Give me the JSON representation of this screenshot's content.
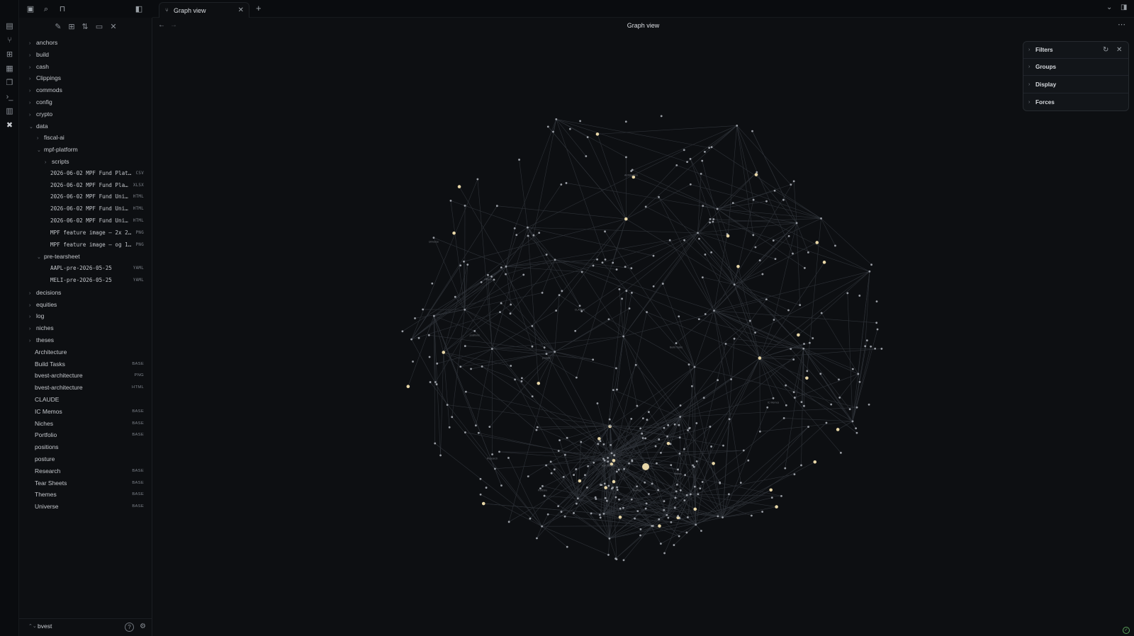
{
  "ribbon": {
    "icons": [
      "file-icon",
      "graph-icon",
      "grid-icon",
      "calendar-icon",
      "copy-icon",
      "terminal-icon",
      "blocks-icon",
      "tools-icon"
    ]
  },
  "sidebar_top": {
    "icons": [
      "folder-icon",
      "search-icon",
      "bookmark-icon",
      "sidebar-toggle-icon"
    ]
  },
  "explorer": {
    "actions": [
      "new-note-icon",
      "new-folder-icon",
      "sort-icon",
      "collapse-icon",
      "close-icon"
    ],
    "items": [
      {
        "label": "anchors",
        "depth": 0,
        "chev": "›"
      },
      {
        "label": "build",
        "depth": 0,
        "chev": "›"
      },
      {
        "label": "cash",
        "depth": 0,
        "chev": "›"
      },
      {
        "label": "Clippings",
        "depth": 0,
        "chev": "›"
      },
      {
        "label": "commods",
        "depth": 0,
        "chev": "›"
      },
      {
        "label": "config",
        "depth": 0,
        "chev": "›"
      },
      {
        "label": "crypto",
        "depth": 0,
        "chev": "›"
      },
      {
        "label": "data",
        "depth": 0,
        "chev": "⌄"
      },
      {
        "label": "fiscal-ai",
        "depth": 1,
        "chev": "›"
      },
      {
        "label": "mpf-platform",
        "depth": 1,
        "chev": "⌄"
      },
      {
        "label": "scripts",
        "depth": 2,
        "chev": "›"
      },
      {
        "label": "2026-06-02 MPF Fund Plat…",
        "depth": 2,
        "ext": "CSV",
        "mono": true
      },
      {
        "label": "2026-06-02 MPF Fund Pla…",
        "depth": 2,
        "ext": "XLSX",
        "mono": true
      },
      {
        "label": "2026-06-02 MPF Fund Uni…",
        "depth": 2,
        "ext": "HTML",
        "mono": true
      },
      {
        "label": "2026-06-02 MPF Fund Uni…",
        "depth": 2,
        "ext": "HTML",
        "mono": true
      },
      {
        "label": "2026-06-02 MPF Fund Uni…",
        "depth": 2,
        "ext": "HTML",
        "mono": true
      },
      {
        "label": "MPF feature image – 2x 2…",
        "depth": 2,
        "ext": "PNG",
        "mono": true
      },
      {
        "label": "MPF feature image – og 1…",
        "depth": 2,
        "ext": "PNG",
        "mono": true
      },
      {
        "label": "pre-tearsheet",
        "depth": 1,
        "chev": "⌄"
      },
      {
        "label": "AAPL-pre-2026-05-25",
        "depth": 2,
        "ext": "YAML",
        "mono": true
      },
      {
        "label": "MELI-pre-2026-05-25",
        "depth": 2,
        "ext": "YAML",
        "mono": true
      },
      {
        "label": "decisions",
        "depth": 0,
        "chev": "›"
      },
      {
        "label": "equities",
        "depth": 0,
        "chev": "›"
      },
      {
        "label": "log",
        "depth": 0,
        "chev": "›"
      },
      {
        "label": "niches",
        "depth": 0,
        "chev": "›"
      },
      {
        "label": "theses",
        "depth": 0,
        "chev": "›"
      },
      {
        "label": "Architecture",
        "depth": 0
      },
      {
        "label": "Build Tasks",
        "depth": 0,
        "ext": "BASE"
      },
      {
        "label": "bvest-architecture",
        "depth": 0,
        "ext": "PNG"
      },
      {
        "label": "bvest-architecture",
        "depth": 0,
        "ext": "HTML"
      },
      {
        "label": "CLAUDE",
        "depth": 0
      },
      {
        "label": "IC Memos",
        "depth": 0,
        "ext": "BASE"
      },
      {
        "label": "Niches",
        "depth": 0,
        "ext": "BASE"
      },
      {
        "label": "Portfolio",
        "depth": 0,
        "ext": "BASE"
      },
      {
        "label": "positions",
        "depth": 0
      },
      {
        "label": "posture",
        "depth": 0
      },
      {
        "label": "Research",
        "depth": 0,
        "ext": "BASE"
      },
      {
        "label": "Tear Sheets",
        "depth": 0,
        "ext": "BASE"
      },
      {
        "label": "Themes",
        "depth": 0,
        "ext": "BASE"
      },
      {
        "label": "Universe",
        "depth": 0,
        "ext": "BASE"
      }
    ]
  },
  "footer": {
    "vault_chev": "⌃⌄",
    "vault_name": "bvest",
    "help_icon": "?",
    "settings_icon": "⚙"
  },
  "tabs": [
    {
      "label": "Graph view",
      "icon": "graph-icon"
    }
  ],
  "tab_new": "+",
  "view": {
    "title": "Graph view",
    "back": "←",
    "forward": "→",
    "more": "⋯"
  },
  "graph_panel": {
    "sections": [
      "Filters",
      "Groups",
      "Display",
      "Forces"
    ],
    "restore_icon": "↻",
    "close_icon": "✕"
  },
  "colors": {
    "background": "#0d0f12",
    "node": "#9a9ea5",
    "node_highlight": "#e8d7a8",
    "edge": "#2e3238",
    "label": "#6c7076"
  },
  "graph_labels": [
    "IC Memos",
    "Build Tasks",
    "Architecture",
    "Niches",
    "Portfolio",
    "Research",
    "Tear Sheets",
    "Themes",
    "Universe",
    "positions",
    "posture",
    "CLAUDE",
    "Filters"
  ]
}
